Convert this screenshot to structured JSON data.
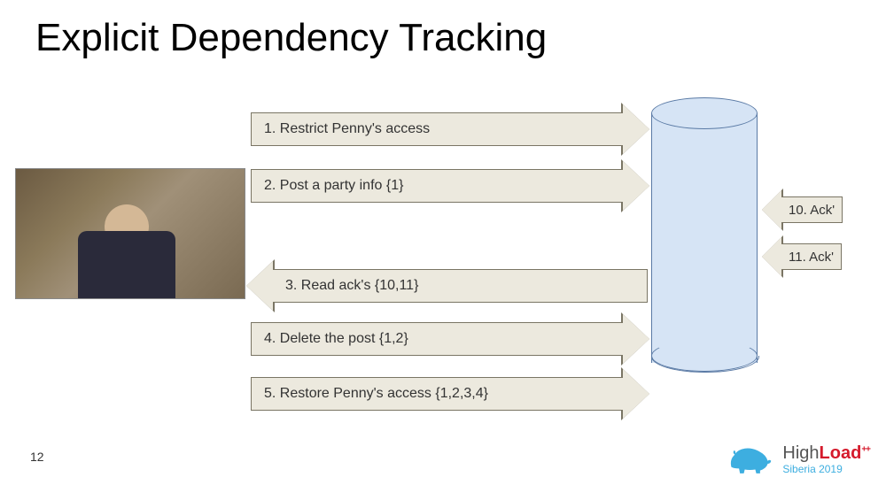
{
  "title": "Explicit Dependency Tracking",
  "arrows": {
    "a1": "1.    Restrict Penny's access",
    "a2": "2. Post a party info {1}",
    "a3": "3. Read ack's {10,11}",
    "a4": "4. Delete the post {1,2}",
    "a5": "5. Restore Penny's access {1,2,3,4}",
    "a10": "10. Ack'",
    "a11": "11. Ack'"
  },
  "page_number": "12",
  "footer": {
    "brand_thin": "High",
    "brand_bold": "Load",
    "brand_plus": "++",
    "brand_sub": "Siberia 2019"
  }
}
